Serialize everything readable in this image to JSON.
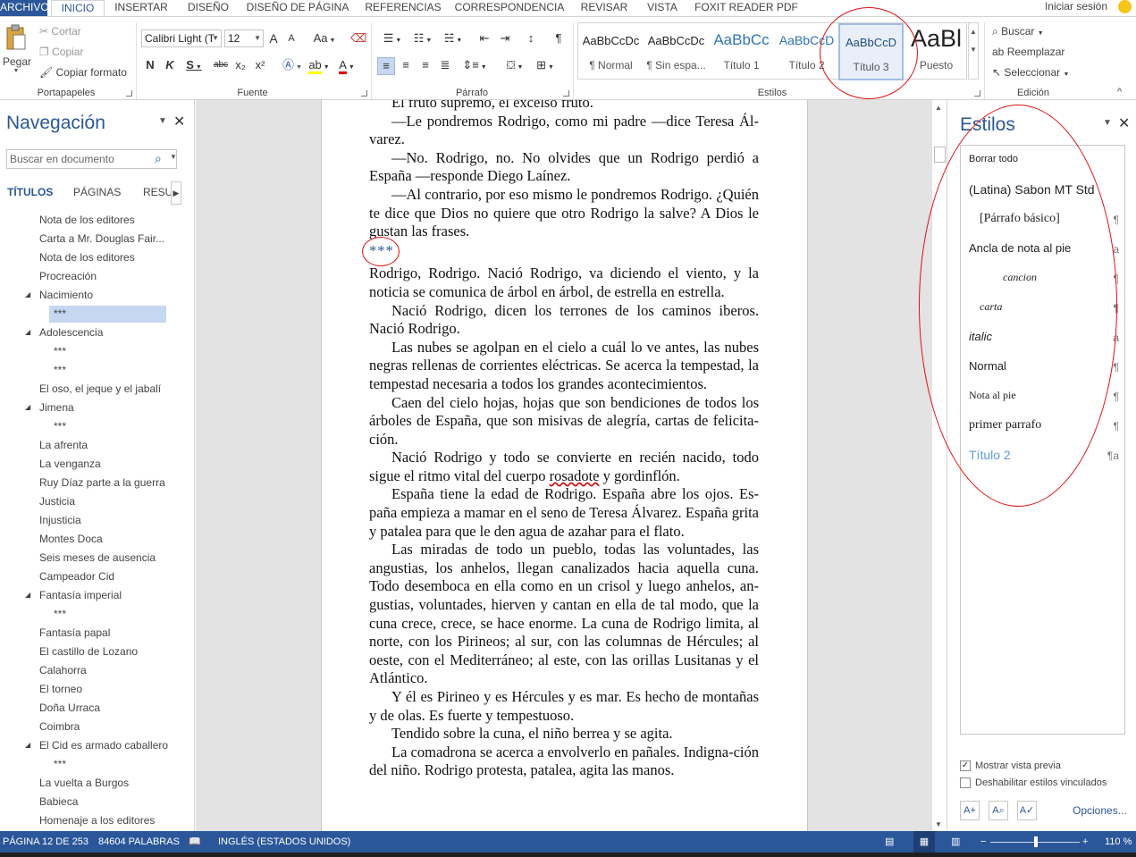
{
  "tabs": {
    "file": "ARCHIVO",
    "home": "INICIO",
    "insert": "INSERTAR",
    "design": "DISEÑO",
    "layout": "DISEÑO DE PÁGINA",
    "references": "REFERENCIAS",
    "mailings": "CORRESPONDENCIA",
    "review": "REVISAR",
    "view": "VISTA",
    "foxit": "FOXIT READER PDF"
  },
  "account": {
    "signin": "Iniciar sesión"
  },
  "clipboard": {
    "paste": "Pegar",
    "cut": "Cortar",
    "copy": "Copiar",
    "format_painter": "Copiar formato",
    "label": "Portapapeles"
  },
  "font": {
    "name": "Calibri Light (T",
    "size": "12",
    "label": "Fuente",
    "bold": "N",
    "italic": "K",
    "underline": "S",
    "strike": "abc",
    "subscript": "x₂",
    "superscript": "x²",
    "change_case": "Aa",
    "grow": "A",
    "shrink": "A"
  },
  "paragraph": {
    "label": "Párrafo"
  },
  "styles_group": {
    "label": "Estilos",
    "items": [
      {
        "preview": "AaBbCcDc",
        "name": "¶ Normal"
      },
      {
        "preview": "AaBbCcDc",
        "name": "¶ Sin espa..."
      },
      {
        "preview": "AaBbCc",
        "name": "Título 1"
      },
      {
        "preview": "AaBbCcD",
        "name": "Título 2"
      },
      {
        "preview": "AaBbCcD",
        "name": "Título 3"
      },
      {
        "preview": "AaBl",
        "name": "Puesto"
      }
    ]
  },
  "editing": {
    "find": "Buscar",
    "replace": "Reemplazar",
    "select": "Seleccionar",
    "label": "Edición"
  },
  "nav_pane": {
    "title": "Navegación",
    "search_placeholder": "Buscar en documento",
    "tabs": [
      "TÍTULOS",
      "PÁGINAS",
      "RESUL"
    ],
    "items": [
      {
        "text": "Nota de los editores",
        "level": 1,
        "expand": false
      },
      {
        "text": "Carta a Mr. Douglas Fair...",
        "level": 1,
        "expand": false
      },
      {
        "text": "Nota de los editores",
        "level": 1,
        "expand": false
      },
      {
        "text": "Procreación",
        "level": 1,
        "expand": false
      },
      {
        "text": "Nacimiento",
        "level": 1,
        "expand": true
      },
      {
        "text": "***",
        "level": 2,
        "expand": false,
        "selected": true
      },
      {
        "text": "Adolescencia",
        "level": 1,
        "expand": true
      },
      {
        "text": "***",
        "level": 2,
        "expand": false
      },
      {
        "text": "***",
        "level": 2,
        "expand": false
      },
      {
        "text": "El oso, el jeque y el jabalí",
        "level": 1,
        "expand": false
      },
      {
        "text": "Jimena",
        "level": 1,
        "expand": true
      },
      {
        "text": "***",
        "level": 2,
        "expand": false
      },
      {
        "text": "La afrenta",
        "level": 1,
        "expand": false
      },
      {
        "text": "La venganza",
        "level": 1,
        "expand": false
      },
      {
        "text": "Ruy Díaz parte a la guerra",
        "level": 1,
        "expand": false
      },
      {
        "text": "Justicia",
        "level": 1,
        "expand": false
      },
      {
        "text": "Injusticia",
        "level": 1,
        "expand": false
      },
      {
        "text": "Montes Doca",
        "level": 1,
        "expand": false
      },
      {
        "text": "Seis meses de ausencia",
        "level": 1,
        "expand": false
      },
      {
        "text": "Campeador Cid",
        "level": 1,
        "expand": false
      },
      {
        "text": "Fantasía imperial",
        "level": 1,
        "expand": true
      },
      {
        "text": "***",
        "level": 2,
        "expand": false
      },
      {
        "text": "Fantasía papal",
        "level": 1,
        "expand": false
      },
      {
        "text": "El castillo de Lozano",
        "level": 1,
        "expand": false
      },
      {
        "text": "Calahorra",
        "level": 1,
        "expand": false
      },
      {
        "text": "El torneo",
        "level": 1,
        "expand": false
      },
      {
        "text": "Doña Urraca",
        "level": 1,
        "expand": false
      },
      {
        "text": "Coimbra",
        "level": 1,
        "expand": false
      },
      {
        "text": "El Cid es armado caballero",
        "level": 1,
        "expand": true
      },
      {
        "text": "***",
        "level": 2,
        "expand": false
      },
      {
        "text": "La vuelta a Burgos",
        "level": 1,
        "expand": false
      },
      {
        "text": "Babieca",
        "level": 1,
        "expand": false
      },
      {
        "text": "Homenaje a los editores",
        "level": 1,
        "expand": false
      }
    ]
  },
  "document": {
    "paragraphs": [
      {
        "text": "El fruto supremo, el excelso fruto.",
        "indent": true
      },
      {
        "text": "—Le pondremos Rodrigo, como mi padre —dice Teresa Ál-varez.",
        "indent": true
      },
      {
        "text": "—No. Rodrigo, no. No olvides que un Rodrigo perdió a España —responde Diego Laínez.",
        "indent": true
      },
      {
        "text": "—Al contrario, por eso mismo le pondremos Rodrigo. ¿Quién te dice que Dios no quiere que otro Rodrigo la salve? A Dios le gustan las frases.",
        "indent": true
      },
      {
        "text": "***",
        "stars": true
      },
      {
        "text": "Rodrigo, Rodrigo. Nació Rodrigo, va diciendo el viento, y la noticia se comunica de árbol en árbol, de estrella en estrella.",
        "indent": false
      },
      {
        "text": "Nació Rodrigo, dicen los terrones de los caminos iberos. Nació Rodrigo.",
        "indent": true
      },
      {
        "text": "Las nubes se agolpan en el cielo a cuál lo ve antes, las nubes negras rellenas de corrientes eléctricas. Se acerca la tempestad, la tempestad necesaria a todos los grandes acontecimientos.",
        "indent": true
      },
      {
        "text": "Caen del cielo hojas, hojas que son bendiciones de todos los árboles de España, que son misivas de alegría, cartas de felicita-ción.",
        "indent": true
      },
      {
        "text": "Nació Rodrigo y todo se convierte en recién nacido, todo sigue el ritmo vital del cuerpo rosadote y gordinflón.",
        "indent": true,
        "squiggle": "rosadote"
      },
      {
        "text": "España tiene la edad de Rodrigo. España abre los ojos. Es-paña empieza a mamar en el seno de Teresa Álvarez. España grita y patalea para que le den agua de azahar para el flato.",
        "indent": true
      },
      {
        "text": "Las miradas de todo un pueblo, todas las voluntades, las angustias, los anhelos, llegan canalizados hacia aquella cuna. Todo desemboca en ella como en un crisol y luego anhelos, an-gustias, voluntades, hierven y cantan en ella de tal modo, que la cuna crece, crece, se hace enorme. La cuna de Rodrigo limita, al norte, con los Pirineos; al sur, con las columnas de Hércules; al oeste, con el Mediterráneo; al este, con las orillas Lusitanas y el Atlántico.",
        "indent": true
      },
      {
        "text": "Y él es Pirineo y es Hércules y es mar. Es hecho de montañas y de olas. Es fuerte y tempestuoso.",
        "indent": true
      },
      {
        "text": "Tendido sobre la cuna, el niño berrea y se agita.",
        "indent": true
      },
      {
        "text": "La comadrona se acerca a envolverlo en pañales. Indigna-ción del niño. Rodrigo protesta, patalea, agita las manos.",
        "indent": true
      }
    ]
  },
  "styles_pane": {
    "title": "Estilos",
    "items": [
      {
        "name": "Borrar todo",
        "mark": ""
      },
      {
        "name": "(Latina) Sabon MT Std",
        "mark": ""
      },
      {
        "name": "[Párrafo básico]",
        "mark": "¶"
      },
      {
        "name": "Ancla de nota al pie",
        "mark": "a"
      },
      {
        "name": "cancion",
        "mark": "¶"
      },
      {
        "name": "carta",
        "mark": "¶"
      },
      {
        "name": "italic",
        "mark": "a"
      },
      {
        "name": "Normal",
        "mark": "¶"
      },
      {
        "name": "Nota al pie",
        "mark": "¶"
      },
      {
        "name": "primer parrafo",
        "mark": "¶"
      },
      {
        "name": "Título 2",
        "mark": "¶a"
      }
    ],
    "show_preview": "Mostrar vista previa",
    "show_preview_checked": true,
    "disable_linked": "Deshabilitar estilos vinculados",
    "disable_linked_checked": false,
    "options": "Opciones..."
  },
  "status": {
    "page": "PÁGINA 12 DE 253",
    "words": "84604 PALABRAS",
    "language": "INGLÉS (ESTADOS UNIDOS)",
    "zoom": "110 %",
    "zoom_level_percent": 110
  },
  "colors": {
    "accent": "#2b579a",
    "annotation": "#e01010",
    "nav_selection": "#c5d7f1"
  }
}
